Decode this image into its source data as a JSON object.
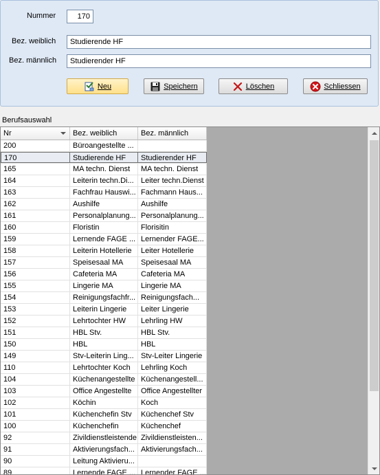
{
  "form": {
    "nummer_label": "Nummer",
    "nummer_value": "170",
    "weiblich_label": "Bez. weiblich",
    "weiblich_value": "Studierende HF",
    "maennlich_label": "Bez. männlich",
    "maennlich_value": "Studierender HF"
  },
  "buttons": {
    "neu": "Neu",
    "speichern": "Speichern",
    "loeschen": "Löschen",
    "schliessen": "Schliessen"
  },
  "section_label": "Berufsauswahl",
  "table": {
    "columns": [
      "Nr",
      "Bez. weiblich",
      "Bez. männlich"
    ],
    "rows": [
      [
        "200",
        "Büroangestellte ...",
        ""
      ],
      [
        "170",
        "Studierende HF",
        "Studierender HF"
      ],
      [
        "165",
        "MA techn. Dienst",
        "MA techn. Dienst"
      ],
      [
        "164",
        "Leiterin techn.Di...",
        "Leiter techn.Dienst"
      ],
      [
        "163",
        "Fachfrau Hauswi...",
        "Fachmann Haus..."
      ],
      [
        "162",
        "Aushilfe",
        "Aushilfe"
      ],
      [
        "161",
        "Personalplanung...",
        "Personalplanung..."
      ],
      [
        "160",
        "Floristin",
        "Florisitin"
      ],
      [
        "159",
        "Lernende FAGE ...",
        "Lernender FAGE..."
      ],
      [
        "158",
        "Leiterin Hotellerie",
        "Leiter Hotellerie"
      ],
      [
        "157",
        "Speisesaal MA",
        "Speisesaal MA"
      ],
      [
        "156",
        "Cafeteria MA",
        "Cafeteria MA"
      ],
      [
        "155",
        "Lingerie MA",
        "Lingerie MA"
      ],
      [
        "154",
        "Reinigungsfachfr...",
        "Reinigungsfach..."
      ],
      [
        "153",
        "Leiterin Lingerie",
        "Leiter Lingerie"
      ],
      [
        "152",
        "Lehrtochter HW",
        "Lehrling HW"
      ],
      [
        "151",
        "HBL Stv.",
        "HBL Stv."
      ],
      [
        "150",
        "HBL",
        "HBL"
      ],
      [
        "149",
        "Stv-Leiterin Ling...",
        "Stv-Leiter Lingerie"
      ],
      [
        "110",
        "Lehrtochter Koch",
        "Lehrling Koch"
      ],
      [
        "104",
        "Küchenangestellte",
        "Küchenangestell..."
      ],
      [
        "103",
        "Office Angestellte",
        "Office Angestellter"
      ],
      [
        "102",
        "Köchin",
        "Koch"
      ],
      [
        "101",
        "Küchenchefin Stv",
        "Küchenchef Stv"
      ],
      [
        "100",
        "Küchenchefin",
        "Küchenchef"
      ],
      [
        "92",
        "Zivildienstleistende",
        "Zivildienstleisten..."
      ],
      [
        "91",
        "Aktivierungsfach...",
        "Aktivierungsfach..."
      ],
      [
        "90",
        "Leitung Aktivieru...",
        ""
      ],
      [
        "89",
        "Lernende FAGE ...",
        "Lernender FAGE ..."
      ]
    ],
    "selected_index": 1
  },
  "colors": {
    "panel_bg": "#dfe9f5",
    "grid_bg": "#ababab",
    "selected_row": "#e9edf3"
  }
}
